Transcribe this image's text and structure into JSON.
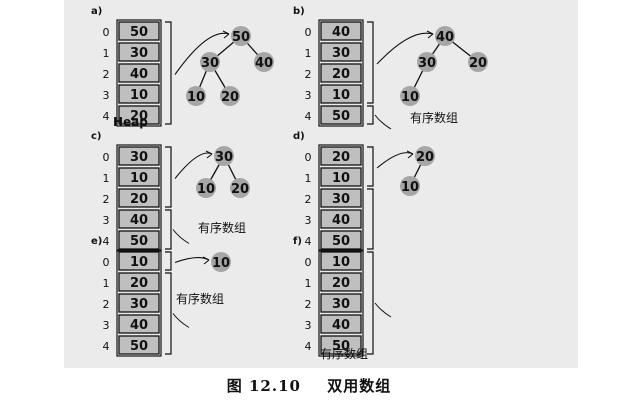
{
  "caption": {
    "label": "图 12.10",
    "title": "双用数组"
  },
  "panels": [
    {
      "id": "a",
      "letter": "a)",
      "cells": [
        "50",
        "30",
        "40",
        "10",
        "20"
      ],
      "sorted_from": null,
      "tree": [
        {
          "v": "50"
        },
        {
          "v": "30",
          "parent": 0
        },
        {
          "v": "40",
          "parent": 0
        },
        {
          "v": "10",
          "parent": 1
        },
        {
          "v": "20",
          "parent": 1
        }
      ],
      "label": "Heap"
    },
    {
      "id": "b",
      "letter": "b)",
      "cells": [
        "40",
        "30",
        "20",
        "10",
        "50"
      ],
      "sorted_from": 4,
      "tree": [
        {
          "v": "40"
        },
        {
          "v": "30",
          "parent": 0
        },
        {
          "v": "20",
          "parent": 0
        },
        {
          "v": "10",
          "parent": 1
        }
      ],
      "label": "有序数组"
    },
    {
      "id": "c",
      "letter": "c)",
      "cells": [
        "30",
        "10",
        "20",
        "40",
        "50"
      ],
      "sorted_from": 3,
      "tree": [
        {
          "v": "30"
        },
        {
          "v": "10",
          "parent": 0
        },
        {
          "v": "20",
          "parent": 0
        }
      ],
      "label": "有序数组"
    },
    {
      "id": "d",
      "letter": "d)",
      "cells": [
        "20",
        "10",
        "30",
        "40",
        "50"
      ],
      "sorted_from": 2,
      "tree": [
        {
          "v": "20"
        },
        {
          "v": "10",
          "parent": 0
        }
      ],
      "label": ""
    },
    {
      "id": "e",
      "letter": "e)",
      "cells": [
        "10",
        "20",
        "30",
        "40",
        "50"
      ],
      "sorted_from": 1,
      "tree": [
        {
          "v": "10"
        }
      ],
      "label": "有序数组"
    },
    {
      "id": "f",
      "letter": "f)",
      "cells": [
        "10",
        "20",
        "30",
        "40",
        "50"
      ],
      "sorted_from": 0,
      "tree": [],
      "label": "有序数组"
    }
  ],
  "indices": [
    "0",
    "1",
    "2",
    "3",
    "4"
  ],
  "colors": {
    "cell": "#bfbfbf",
    "node": "#a6a6a6",
    "ink": "#111111",
    "panel": "#ebebeb"
  }
}
